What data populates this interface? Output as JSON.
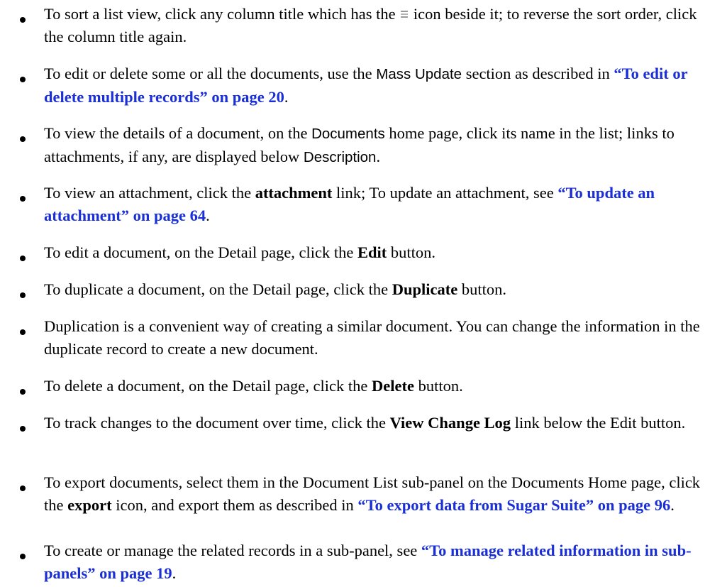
{
  "items": [
    {
      "t1": "To sort a list view, click any column title which has the",
      "icon": "sort-icon",
      "t2": "icon beside it; to reverse the sort order, click the column title again."
    },
    {
      "t1": "To edit or delete some or all the documents, use the",
      "s1": "Mass Update",
      "t2": "section as described in",
      "link": "“To edit or delete multiple records” on page 20",
      "t3": "."
    },
    {
      "t1": "To view the details of a document, on the",
      "s1": "Documents",
      "t2": "home page, click its name in the list; links to attachments, if any, are displayed below",
      "s2": "Description",
      "t3": "."
    },
    {
      "t1": "To view an attachment, click the",
      "b1": "attachment",
      "t2": "link; To update an attachment, see",
      "link": "“To update an attachment” on page 64",
      "t3": "."
    },
    {
      "t1": "To edit a document, on the Detail page, click the",
      "b1": "Edit",
      "t2": "button."
    },
    {
      "t1": "To duplicate a document, on the Detail page, click the",
      "b1": "Duplicate",
      "t2": "button."
    },
    {
      "t1": "Duplication is a convenient way of creating a similar document. You can change the information in the duplicate record to create a new document."
    },
    {
      "t1": "To delete a document, on the Detail page, click the",
      "b1": "Delete",
      "t2": "button."
    },
    {
      "t1": "To track changes to the document over time, click the",
      "b1": "View Change Log",
      "t2": "link below the Edit button."
    },
    {
      "t1": "To export documents, select them in the Document List sub-panel on the Documents Home page, click the",
      "b1": "export",
      "t2": "icon, and export them as described in",
      "link": "“To export data from Sugar Suite” on page 96",
      "t3": "."
    },
    {
      "t1": "To create or manage the related records in a sub-panel, see",
      "link": "“To manage related information in sub-panels” on page 19",
      "t3": "."
    }
  ]
}
